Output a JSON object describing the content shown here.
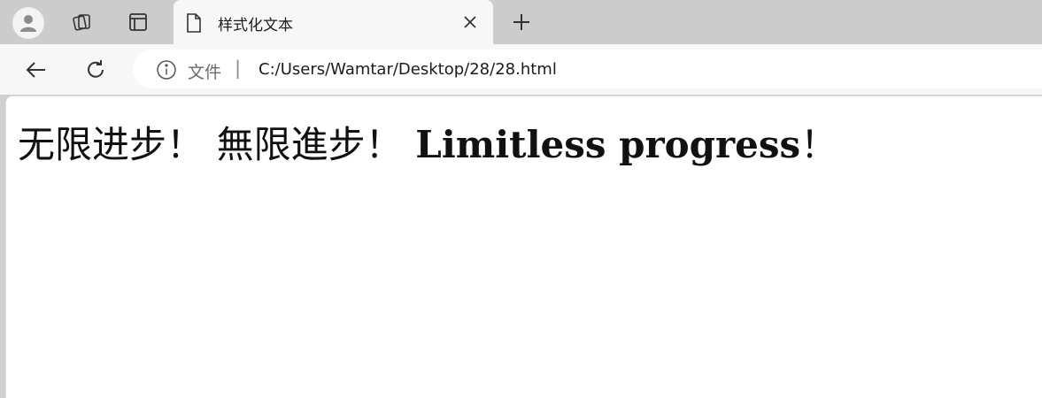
{
  "browser": {
    "tab": {
      "title": "样式化文本"
    },
    "address": {
      "scheme_label": "文件",
      "separator": "|",
      "url": "C:/Users/Wamtar/Desktop/28/28.html"
    }
  },
  "icons": {
    "profile": "profile-avatar-icon",
    "workspaces": "workspaces-icon",
    "tab_actions": "tab-actions-icon",
    "document": "document-icon",
    "close": "close-icon",
    "new_tab": "plus-icon",
    "back": "back-arrow-icon",
    "reload": "reload-icon",
    "info": "info-icon"
  },
  "page": {
    "heading": {
      "simplified": "无限进步！",
      "traditional": "無限進步！",
      "english": "Limitless progress",
      "punct": "！"
    }
  }
}
